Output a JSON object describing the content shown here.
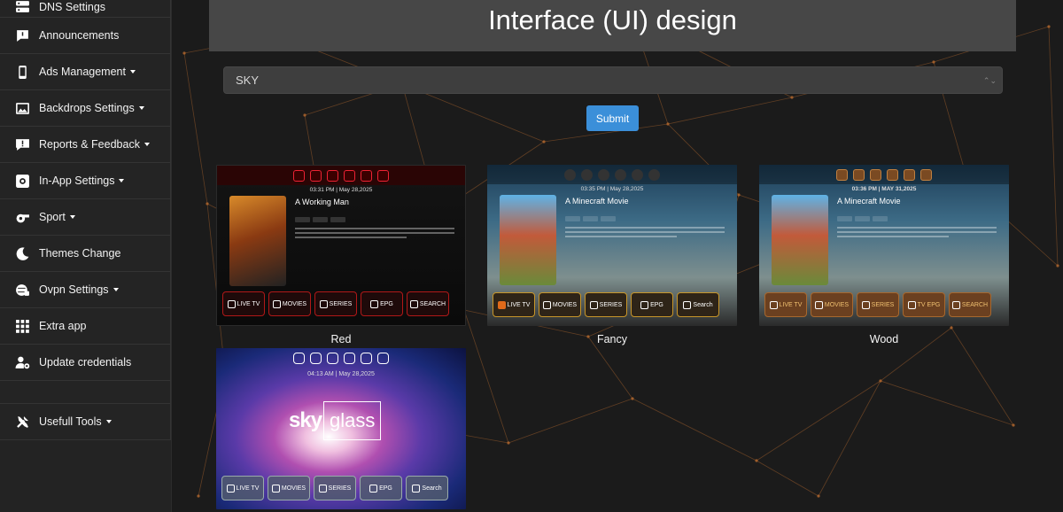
{
  "sidebar": {
    "items": [
      {
        "label": "DNS Settings",
        "icon": "server-icon",
        "dropdown": false
      },
      {
        "label": "Announcements",
        "icon": "message-icon",
        "dropdown": false
      },
      {
        "label": "Ads Management",
        "icon": "mobile-icon",
        "dropdown": true
      },
      {
        "label": "Backdrops Settings",
        "icon": "image-icon",
        "dropdown": true
      },
      {
        "label": "Reports & Feedback",
        "icon": "comment-alert-icon",
        "dropdown": true
      },
      {
        "label": "In-App Settings",
        "icon": "app-settings-icon",
        "dropdown": true
      },
      {
        "label": "Sport",
        "icon": "whistle-icon",
        "dropdown": true
      },
      {
        "label": "Themes Change",
        "icon": "moon-icon",
        "dropdown": false
      },
      {
        "label": "Ovpn Settings",
        "icon": "globe-lock-icon",
        "dropdown": true
      },
      {
        "label": "Extra app",
        "icon": "grid-icon",
        "dropdown": false
      },
      {
        "label": "Update credentials",
        "icon": "user-cog-icon",
        "dropdown": false
      },
      {
        "label": "Usefull Tools",
        "icon": "tools-icon",
        "dropdown": true
      }
    ]
  },
  "header": {
    "title": "Interface (UI) design"
  },
  "form": {
    "theme_select_value": "SKY",
    "submit_label": "Submit"
  },
  "themes": [
    {
      "label": "Red",
      "preview": {
        "clock": "03:31 PM  |  May 28,2025",
        "movie_title": "A Working Man",
        "buttons": [
          "LIVE TV",
          "MOVIES",
          "SERIES",
          "EPG",
          "SEARCH"
        ]
      }
    },
    {
      "label": "Fancy",
      "preview": {
        "clock": "03:35 PM  |  May 28,2025",
        "movie_title": "A Minecraft Movie",
        "buttons": [
          "LIVE TV",
          "MOVIES",
          "SERIES",
          "EPG",
          "Search"
        ]
      }
    },
    {
      "label": "Wood",
      "preview": {
        "clock": "03:36 PM  |  MAY 31,2025",
        "movie_title": "A Minecraft Movie",
        "buttons": [
          "LIVE TV",
          "MOVIES",
          "SERIES",
          "TV EPG",
          "SEARCH"
        ]
      }
    },
    {
      "label": "",
      "preview": {
        "clock": "04:13 AM  |  May 28,2025",
        "brand": "sky",
        "brand_box": "glass",
        "buttons": [
          "LIVE TV",
          "MOVIES",
          "SERIES",
          "EPG",
          "Search"
        ]
      }
    }
  ],
  "colors": {
    "accent": "#3b8fd9",
    "sidebar_bg": "#242424",
    "header_bg": "#474747",
    "network_lines": "#b5692e"
  }
}
